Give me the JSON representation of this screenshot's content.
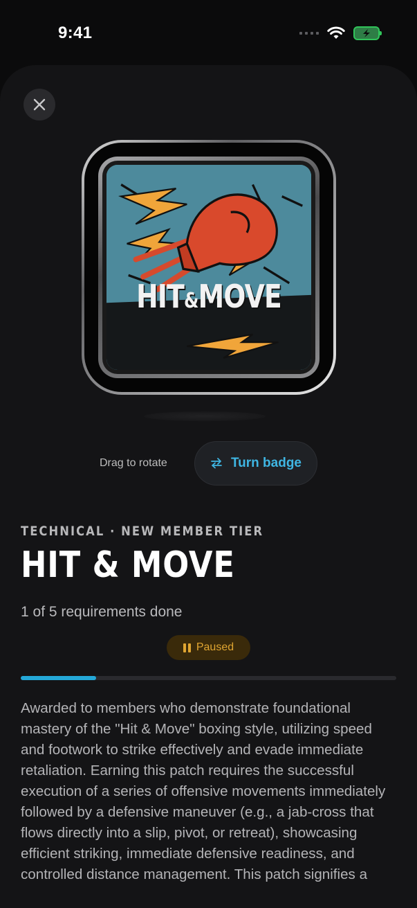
{
  "status_bar": {
    "time": "9:41"
  },
  "badge": {
    "art_text_left": "HIT",
    "art_text_amp": "&",
    "art_text_right": "MOVE"
  },
  "controls": {
    "drag_hint": "Drag to rotate",
    "turn_button": "Turn badge"
  },
  "details": {
    "category": "TECHNICAL · NEW MEMBER TIER",
    "title": "HIT & MOVE",
    "progress_text": "1 of 5 requirements done",
    "status_label": "Paused",
    "progress_fraction": 0.2,
    "description": "Awarded to members who demonstrate foundational mastery of the \"Hit & Move\" boxing style, utilizing speed and footwork to strike effectively and evade immediate retaliation. Earning this patch requires the successful execution of a series of offensive movements immediately followed by a defensive maneuver (e.g., a jab-cross that flows directly into a slip, pivot, or retreat), showcasing efficient striking, immediate defensive readiness, and controlled distance management. This patch signifies a"
  },
  "colors": {
    "accent": "#3fb6e3",
    "progress": "#24a8d8",
    "paused": "#e0a531",
    "sheet_bg": "#141416"
  },
  "icons": {
    "close": "close-icon",
    "rotate": "swap-arrows-icon",
    "pause": "pause-icon",
    "wifi": "wifi-icon",
    "battery": "battery-charging-icon"
  }
}
